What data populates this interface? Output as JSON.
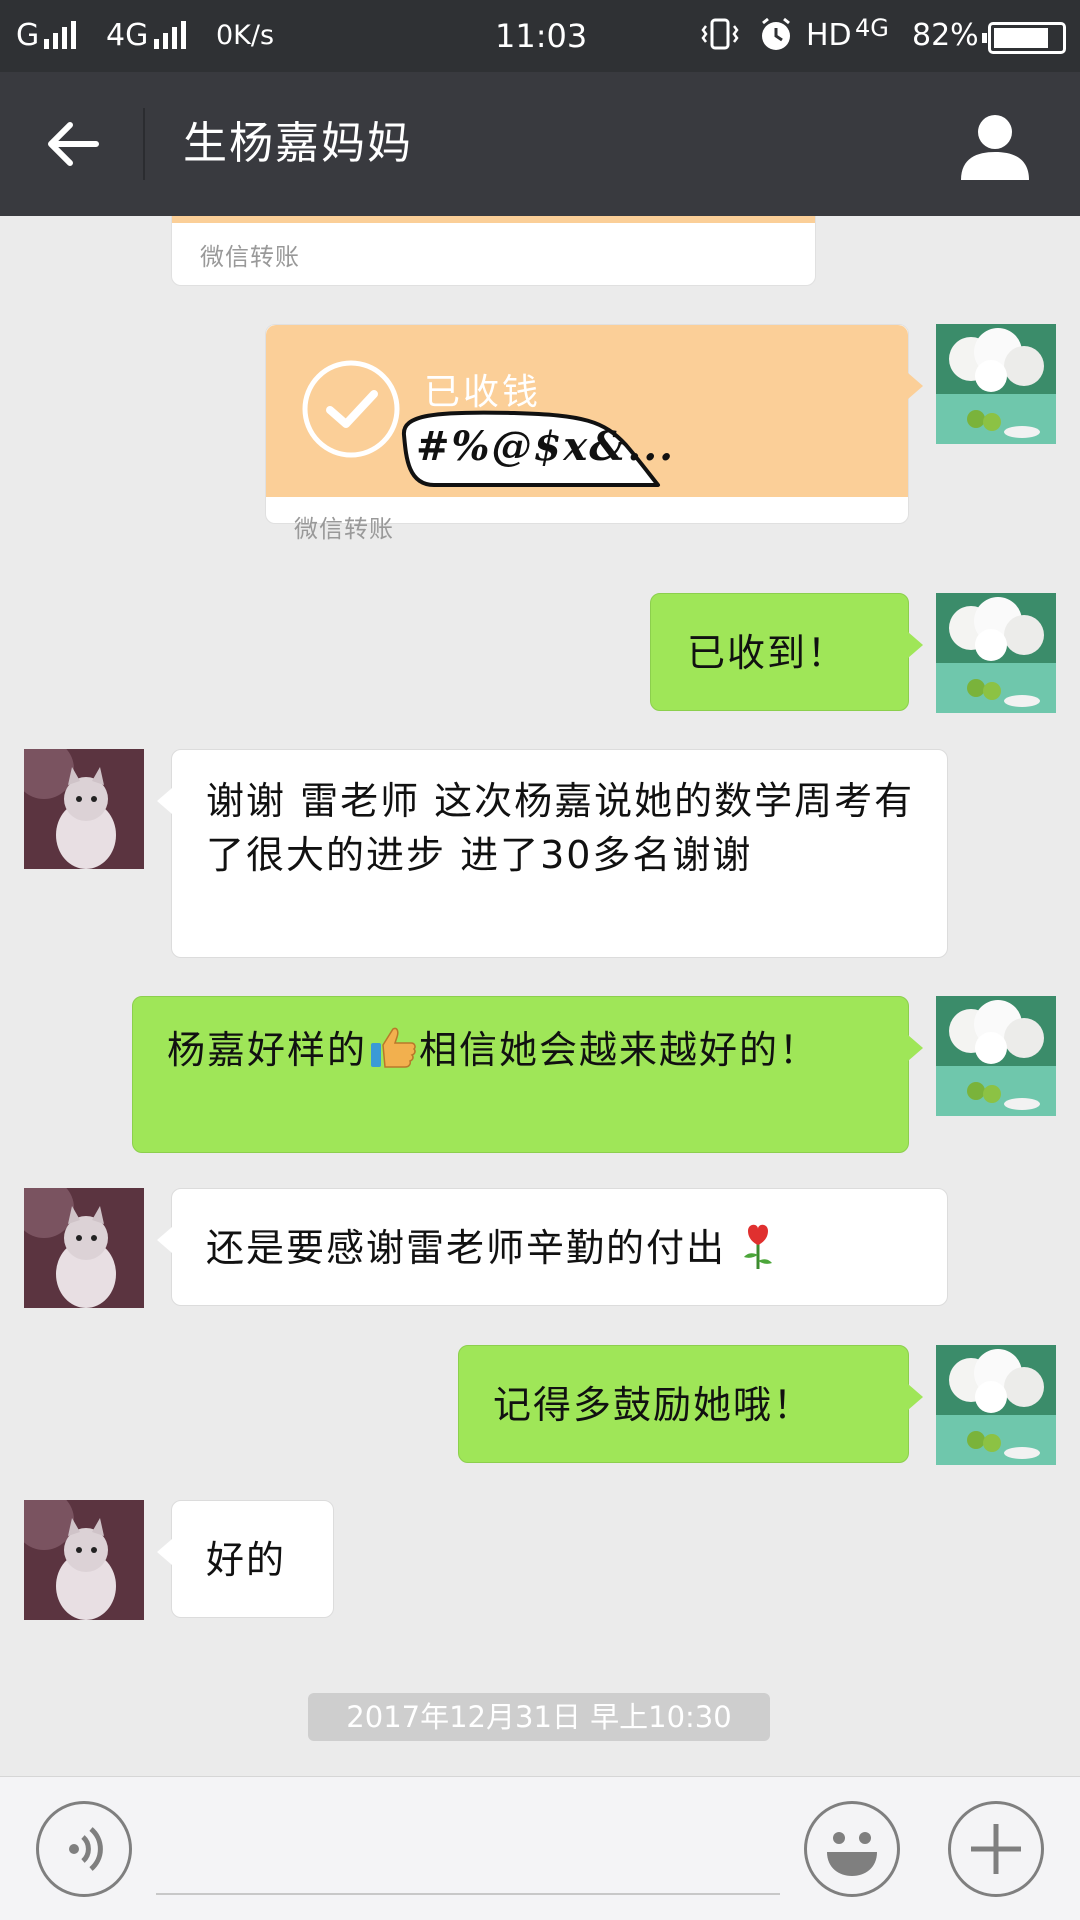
{
  "status_bar": {
    "carrier_1": "G",
    "carrier_2": "4G",
    "net_speed": "0K/s",
    "time": "11:03",
    "hd": "HD",
    "network_type": "4G",
    "battery_percent": "82%",
    "battery_level": 0.82
  },
  "header": {
    "title": "生杨嘉妈妈"
  },
  "messages": {
    "transfer_1": {
      "footer": "微信转账"
    },
    "transfer_2": {
      "status": "已收钱",
      "sticker_text": "#%@$x&...",
      "footer": "微信转账"
    },
    "msg_received_ack": "已收到！",
    "msg_thanks": "谢谢 雷老师 这次杨嘉说她的数学周考有了很大的进步 进了30多名谢谢",
    "msg_praise_part1": "杨嘉好样的",
    "msg_praise_part2": "相信她会越来越好的！",
    "msg_gratitude": "还是要感谢雷老师辛勤的付出",
    "msg_encourage": "记得多鼓励她哦！",
    "msg_ok": "好的"
  },
  "timestamp": "2017年12月31日 早上10:30",
  "input": {
    "value": "",
    "placeholder": ""
  },
  "icons": [
    "back-arrow-icon",
    "profile-icon",
    "voice-icon",
    "emoji-icon",
    "plus-icon",
    "thumbs-up-icon",
    "rose-icon",
    "check-circle-icon"
  ],
  "colors": {
    "green_bubble": "#9fe658",
    "transfer_orange": "#fbcf98",
    "title_bar": "#393a3f",
    "chat_bg": "#ebebeb"
  }
}
